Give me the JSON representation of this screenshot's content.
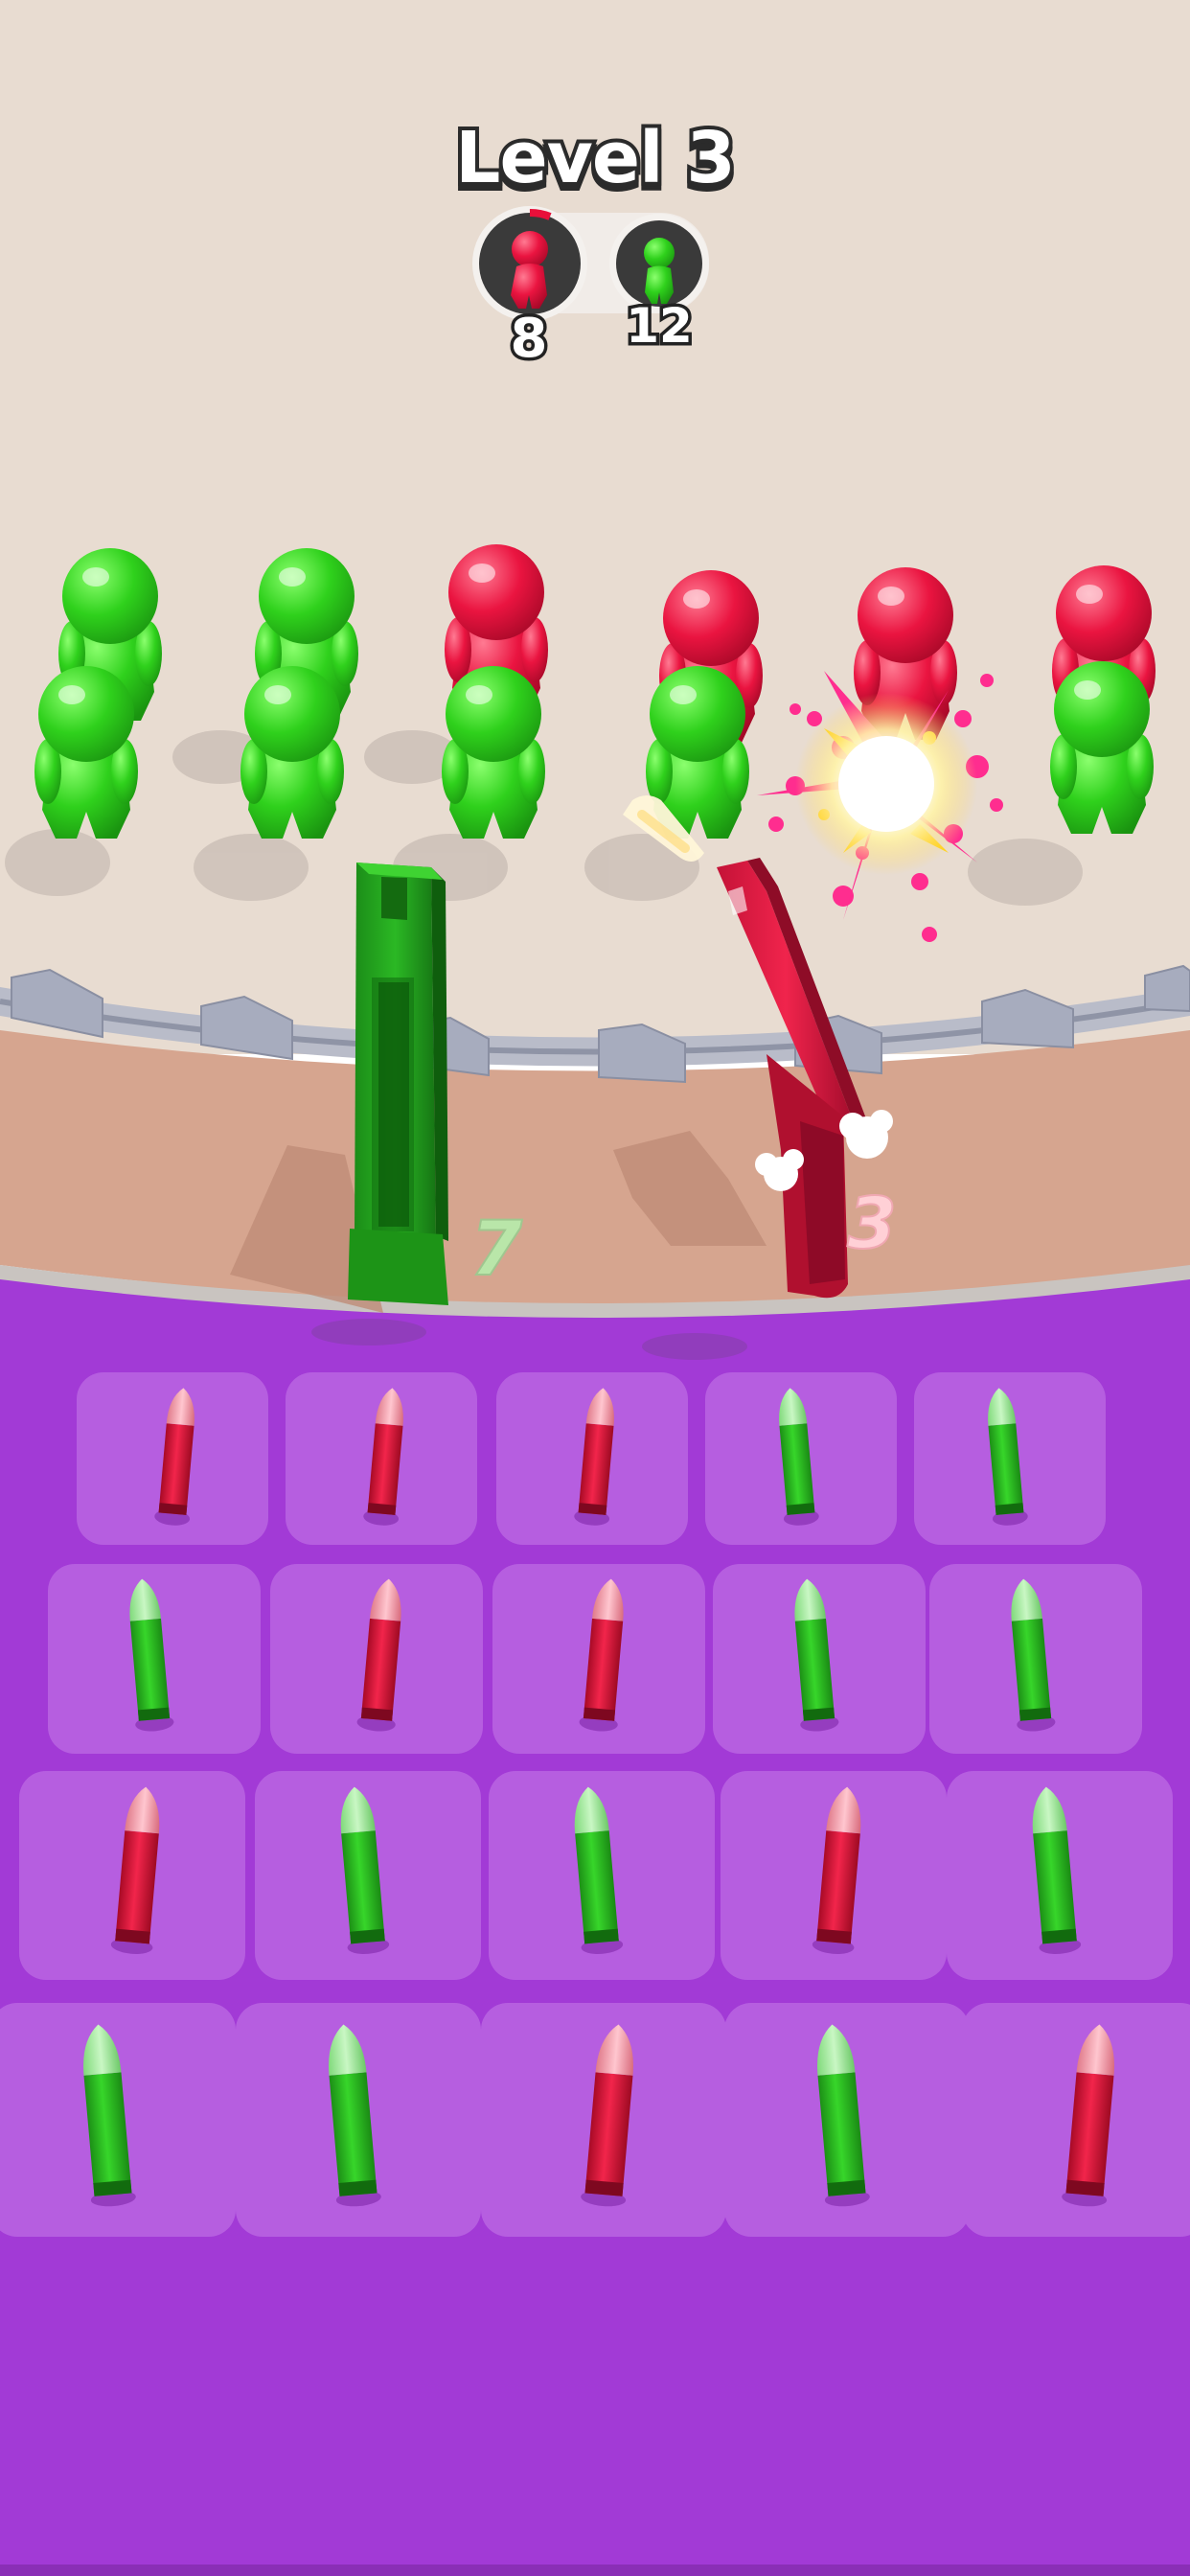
{
  "hud": {
    "level_label": "Level 3",
    "red_team": {
      "remaining": "8",
      "color": "#e8103a",
      "icon": "red-stickman-icon"
    },
    "green_team": {
      "remaining": "12",
      "color": "#2fd11c",
      "icon": "green-stickman-icon"
    }
  },
  "weapons": {
    "green_magazine": {
      "ammo": "7",
      "color": "#27b51e",
      "icon": "green-magazine-icon"
    },
    "red_pistol": {
      "ammo": "3",
      "color": "#e01a40",
      "icon": "red-pistol-icon"
    }
  },
  "colors": {
    "arena_floor": "#e8dcd1",
    "track": "#d6a58f",
    "tray": "#a23ad6",
    "slot": "#b65ee0",
    "red": "#e8103a",
    "green": "#2fd11c"
  },
  "crowd": {
    "back_row": [
      "green",
      "green",
      "red",
      "red",
      "red",
      "red"
    ],
    "front_row": [
      "green",
      "green",
      "green",
      "green",
      "empty",
      "green"
    ]
  },
  "bullet_grid": [
    [
      "red",
      "red",
      "red",
      "green",
      "green"
    ],
    [
      "green",
      "red",
      "red",
      "green",
      "green"
    ],
    [
      "red",
      "green",
      "green",
      "red",
      "green"
    ],
    [
      "green",
      "green",
      "red",
      "green",
      "red"
    ]
  ]
}
